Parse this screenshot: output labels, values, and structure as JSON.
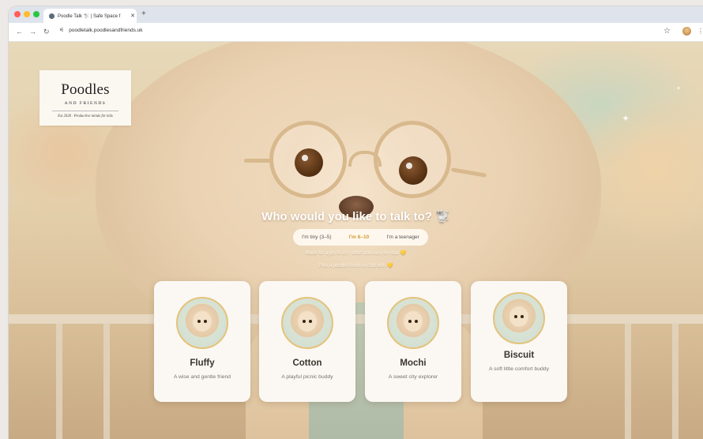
{
  "browser": {
    "tab_title": "Poodle Talk 🐩 | Safe Space f",
    "tab_close": "✕",
    "new_tab": "+",
    "back": "←",
    "forward": "→",
    "reload": "↻",
    "url": "poodletalk.poodlesandfriends.uk",
    "bookmark": "☆",
    "menu": "⋮"
  },
  "logo": {
    "name": "Poodles",
    "subtitle": "AND FRIENDS",
    "tagline": "Est 2026 · Productive minds for kids"
  },
  "hero": {
    "headline": "Who would you like to talk to? 🐩",
    "age_options": [
      {
        "label": "I'm tiny (3–5)",
        "active": false
      },
      {
        "label": "I'm 6–10",
        "active": true
      },
      {
        "label": "I'm a teenager",
        "active": false
      }
    ],
    "note1": "Made for ages 6–10 · short and easy to read 💛",
    "note2": "Pick a poodle friend to chat with 💛"
  },
  "characters": [
    {
      "name": "Fluffy",
      "description": "A wise and gentle friend"
    },
    {
      "name": "Cotton",
      "description": "A playful picnic buddy"
    },
    {
      "name": "Mochi",
      "description": "A sweet city explorer"
    },
    {
      "name": "Biscuit",
      "description": "A soft little comfort buddy"
    }
  ],
  "colors": {
    "accent": "#d49a2e",
    "card_bg": "#fbf8f4",
    "avatar_ring": "#e5c27a"
  }
}
